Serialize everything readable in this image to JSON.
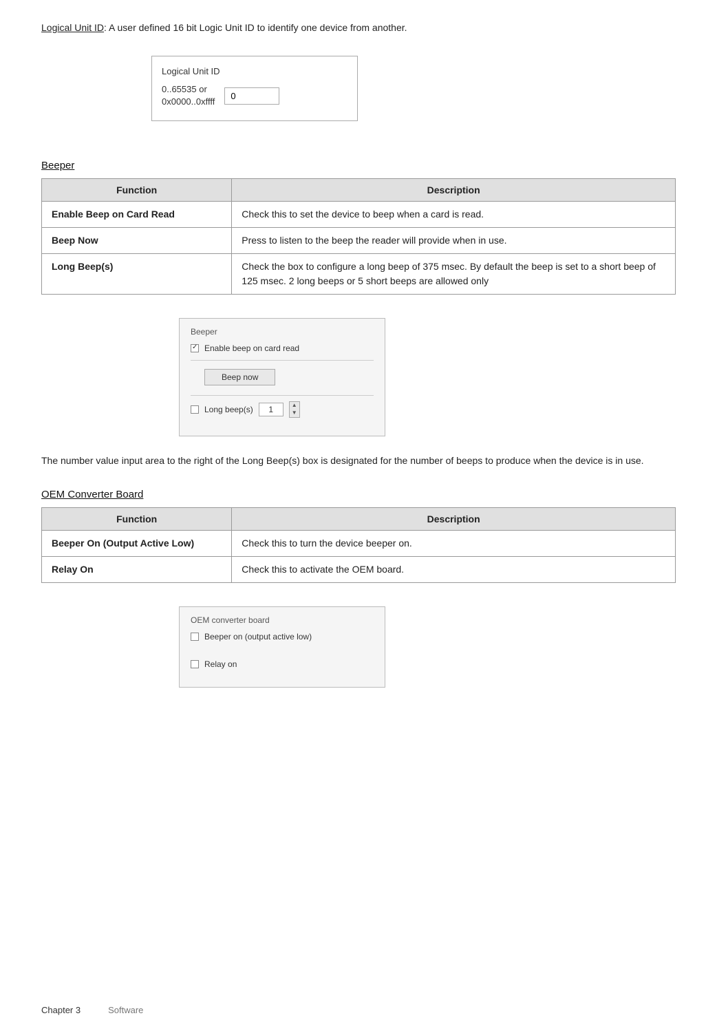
{
  "intro": {
    "label_link": "Logical Unit ID",
    "label_rest": ": A user defined 16 bit Logic Unit ID to identify one device from another."
  },
  "logical_unit": {
    "box_label": "Logical Unit ID",
    "range_text": "0..65535 or\n0x0000..0xffff",
    "input_value": "0"
  },
  "beeper_section": {
    "heading": "Beeper",
    "table": {
      "col1": "Function",
      "col2": "Description",
      "rows": [
        {
          "function": "Enable Beep on Card Read",
          "description": "Check this to set the device to beep when a card is read."
        },
        {
          "function": "Beep Now",
          "description": "Press to listen to the beep the reader will provide when in use."
        },
        {
          "function": "Long Beep(s)",
          "description": "Check the box to configure a long beep of 375 msec. By default the beep is set to a short beep of 125 msec. 2 long beeps or 5 short beeps are allowed only"
        }
      ]
    },
    "mockup": {
      "title": "Beeper",
      "enable_checkbox_checked": true,
      "enable_label": "Enable beep on card read",
      "beep_now_label": "Beep now",
      "long_beep_label": "Long beep(s)",
      "long_beep_checked": false,
      "long_beep_value": "1"
    }
  },
  "beeper_para": "The number value input area to the right of the Long Beep(s) box is designated for the number of beeps to produce when the device is in use.",
  "oem_section": {
    "heading": "OEM Converter Board",
    "table": {
      "col1": "Function",
      "col2": "Description",
      "rows": [
        {
          "function": "Beeper On (Output Active Low)",
          "description": "Check this to turn the device beeper on."
        },
        {
          "function": "Relay On",
          "description": "Check this to activate the OEM board."
        }
      ]
    },
    "mockup": {
      "title": "OEM converter board",
      "beeper_on_label": "Beeper on (output active low)",
      "beeper_on_checked": false,
      "relay_on_label": "Relay on",
      "relay_on_checked": false
    }
  },
  "footer": {
    "chapter": "Chapter 3",
    "section": "Software"
  }
}
